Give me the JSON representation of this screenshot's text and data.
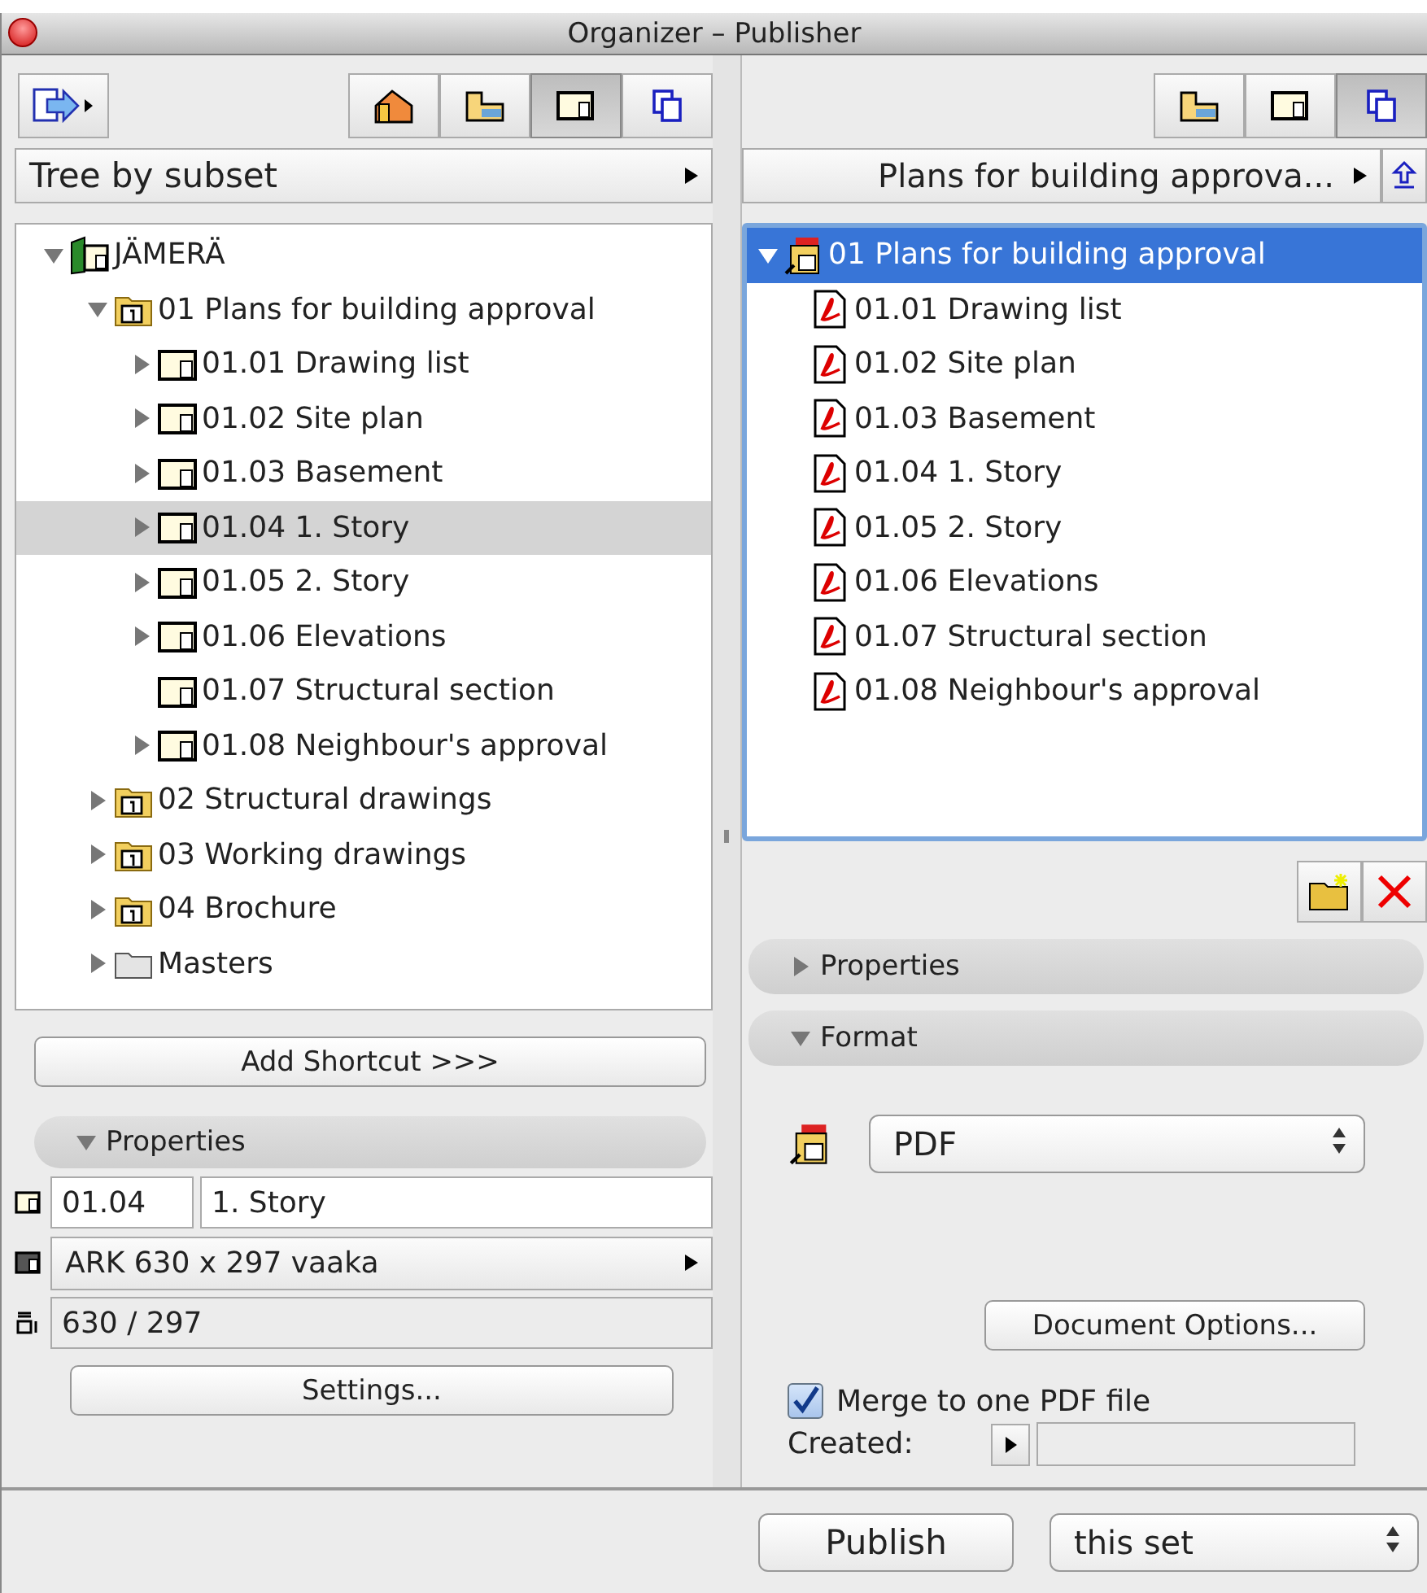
{
  "window": {
    "title": "Organizer – Publisher"
  },
  "left": {
    "view_buttons": [
      {
        "kind": "project",
        "selected": false
      },
      {
        "kind": "folder",
        "selected": false
      },
      {
        "kind": "layout",
        "selected": true
      },
      {
        "kind": "sets",
        "selected": false
      }
    ],
    "mode": "Tree by subset",
    "tree": [
      {
        "label": "JÄMERÄ",
        "kind": "project",
        "expanded": true,
        "selected": false,
        "children": [
          {
            "label": "01 Plans for building approval",
            "kind": "subset",
            "expanded": true,
            "selected": false,
            "children": [
              {
                "label": "01.01 Drawing list",
                "kind": "layout",
                "expanded": false,
                "selected": false,
                "has_children": true
              },
              {
                "label": "01.02 Site plan",
                "kind": "layout",
                "expanded": false,
                "selected": false,
                "has_children": true
              },
              {
                "label": "01.03 Basement",
                "kind": "layout",
                "expanded": false,
                "selected": false,
                "has_children": true
              },
              {
                "label": "01.04 1. Story",
                "kind": "layout",
                "expanded": false,
                "selected": true,
                "has_children": true
              },
              {
                "label": "01.05 2. Story",
                "kind": "layout",
                "expanded": false,
                "selected": false,
                "has_children": true
              },
              {
                "label": "01.06 Elevations",
                "kind": "layout",
                "expanded": false,
                "selected": false,
                "has_children": true
              },
              {
                "label": "01.07 Structural section",
                "kind": "layout",
                "expanded": false,
                "selected": false,
                "has_children": false
              },
              {
                "label": "01.08 Neighbour's approval",
                "kind": "layout",
                "expanded": false,
                "selected": false,
                "has_children": true
              }
            ]
          },
          {
            "label": "02 Structural drawings",
            "kind": "subset",
            "expanded": false,
            "selected": false,
            "has_children": true
          },
          {
            "label": "03 Working drawings",
            "kind": "subset",
            "expanded": false,
            "selected": false,
            "has_children": true
          },
          {
            "label": "04 Brochure",
            "kind": "subset",
            "expanded": false,
            "selected": false,
            "has_children": true
          },
          {
            "label": "Masters",
            "kind": "folder",
            "expanded": false,
            "selected": false,
            "has_children": true
          }
        ]
      }
    ],
    "add_shortcut": "Add Shortcut >>>",
    "properties": {
      "title": "Properties",
      "expanded": true,
      "id": "01.04",
      "name": "1. Story",
      "master": "ARK 630 x 297 vaaka",
      "size": "630 / 297",
      "settings": "Settings..."
    }
  },
  "right": {
    "view_buttons": [
      {
        "kind": "folder",
        "selected": false
      },
      {
        "kind": "layout",
        "selected": false
      },
      {
        "kind": "sets",
        "selected": true
      }
    ],
    "set": "Plans for building approva...",
    "tree": [
      {
        "label": "01 Plans for building approval",
        "kind": "pubset",
        "expanded": true,
        "selected": true,
        "children": [
          {
            "label": "01.01 Drawing list",
            "kind": "pdf",
            "selected": false
          },
          {
            "label": "01.02 Site plan",
            "kind": "pdf",
            "selected": false
          },
          {
            "label": "01.03 Basement",
            "kind": "pdf",
            "selected": false
          },
          {
            "label": "01.04 1. Story",
            "kind": "pdf",
            "selected": false
          },
          {
            "label": "01.05 2. Story",
            "kind": "pdf",
            "selected": false
          },
          {
            "label": "01.06 Elevations",
            "kind": "pdf",
            "selected": false
          },
          {
            "label": "01.07 Structural section",
            "kind": "pdf",
            "selected": false
          },
          {
            "label": "01.08 Neighbour's approval",
            "kind": "pdf",
            "selected": false
          }
        ]
      }
    ],
    "sections": [
      {
        "title": "Properties",
        "expanded": false
      },
      {
        "title": "Format",
        "expanded": true
      }
    ],
    "format": "PDF",
    "document_options": "Document Options...",
    "merge": {
      "label": "Merge to one PDF file",
      "checked": true
    },
    "created_label": "Created:"
  },
  "footer": {
    "publish": "Publish",
    "scope": "this set"
  }
}
